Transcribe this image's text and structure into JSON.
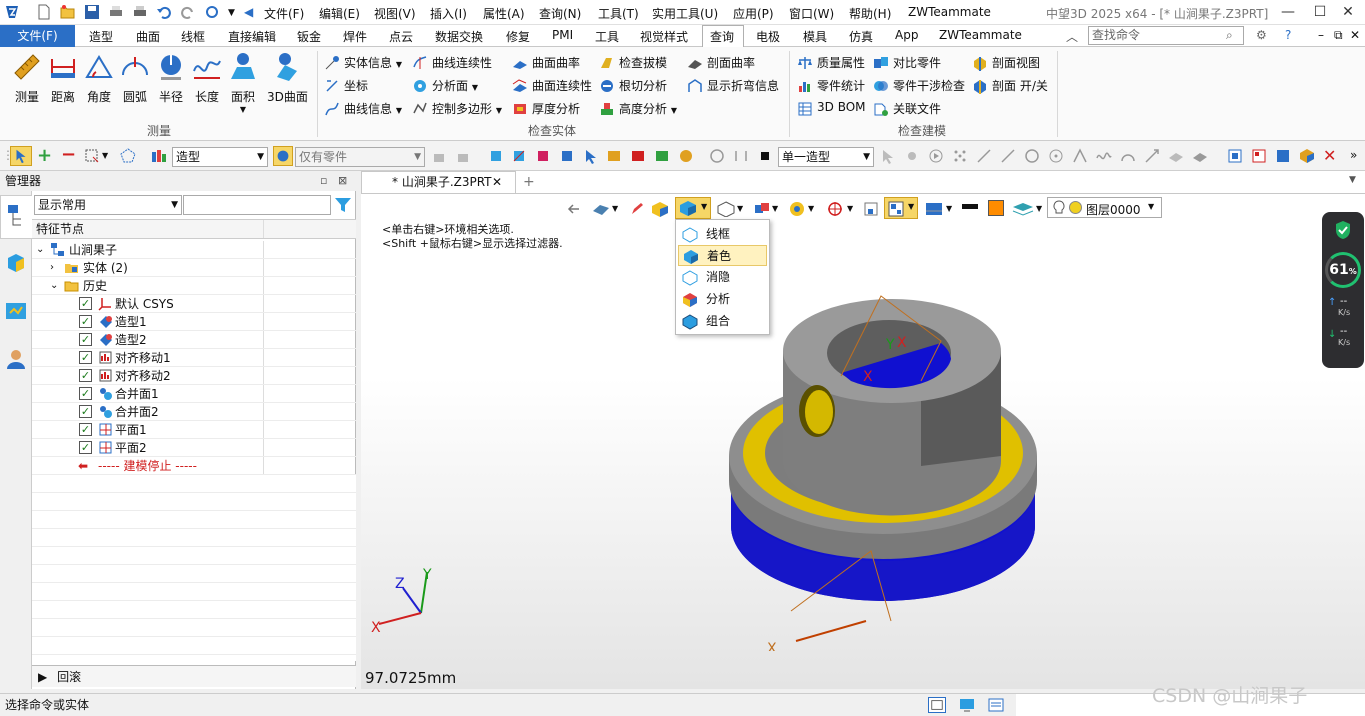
{
  "window": {
    "title": "中望3D 2025 x64 - [* 山涧果子.Z3PRT]"
  },
  "menubar": {
    "items": [
      "文件(F)",
      "编辑(E)",
      "视图(V)",
      "插入(I)",
      "属性(A)",
      "查询(N)",
      "工具(T)",
      "实用工具(U)",
      "应用(P)",
      "窗口(W)",
      "帮助(H)",
      "ZWTeammate"
    ]
  },
  "tabs": {
    "file": "文件(F)",
    "items": [
      "造型",
      "曲面",
      "线框",
      "直接编辑",
      "钣金",
      "焊件",
      "点云",
      "数据交换",
      "修复",
      "PMI",
      "工具",
      "视觉样式",
      "查询",
      "电极",
      "模具",
      "仿真",
      "App",
      "ZWTeammate"
    ],
    "active": "查询"
  },
  "search": {
    "placeholder": "查找命令"
  },
  "ribbon": {
    "measure": {
      "label": "测量",
      "buttons": [
        "测量",
        "距离",
        "角度",
        "圆弧",
        "半径",
        "长度",
        "面积",
        "3D曲面"
      ]
    },
    "inspect_entity": {
      "label": "检查实体",
      "col1": [
        "实体信息",
        "坐标",
        "曲线信息"
      ],
      "col2": [
        "曲线连续性",
        "分析面",
        "控制多边形"
      ],
      "col3": [
        "曲面曲率",
        "曲面连续性",
        "厚度分析"
      ],
      "col4": [
        "检查拔模",
        "根切分析",
        "高度分析"
      ],
      "col5": [
        "剖面曲率",
        "显示折弯信息"
      ]
    },
    "inspect_model": {
      "label": "检查建模",
      "col1": [
        "质量属性",
        "零件统计",
        "3D BOM"
      ],
      "col2": [
        "对比零件",
        "零件干涉检查",
        "关联文件"
      ],
      "col3": [
        "剖面视图",
        "剖面 开/关"
      ]
    }
  },
  "toolbar2": {
    "combo1": "造型",
    "combo2": "仅有零件",
    "combo3": "单一造型"
  },
  "manager": {
    "title": "管理器",
    "filter": "显示常用",
    "column": "特征节点",
    "root": "山涧果子",
    "entity": "实体 (2)",
    "history": "历史",
    "features": [
      "默认 CSYS",
      "造型1",
      "造型2",
      "对齐移动1",
      "对齐移动2",
      "合并面1",
      "合并面2",
      "平面1",
      "平面2"
    ],
    "stop": "----- 建模停止 -----",
    "rollback": "回滚"
  },
  "viewport": {
    "doc_tab": "* 山涧果子.Z3PRT",
    "hint1": "<单击右键>环境相关选项.",
    "hint2": "<Shift +鼠标右键>显示选择过滤器.",
    "measure": "97.0725mm",
    "layer": "图层0000"
  },
  "dropdown": {
    "items": [
      "线框",
      "着色",
      "消隐",
      "分析",
      "组合"
    ],
    "selected": "着色"
  },
  "perf": {
    "value": "61",
    "unit": "%",
    "up": "--",
    "down": "--",
    "rate": "K/s"
  },
  "status": {
    "text": "选择命令或实体",
    "watermark": "CSDN @山涧果子"
  },
  "colors": {
    "accent": "#2b6fc6",
    "part_blue": "#1010d0",
    "part_yellow": "#e0c000",
    "part_gray": "#8a8a8a"
  }
}
